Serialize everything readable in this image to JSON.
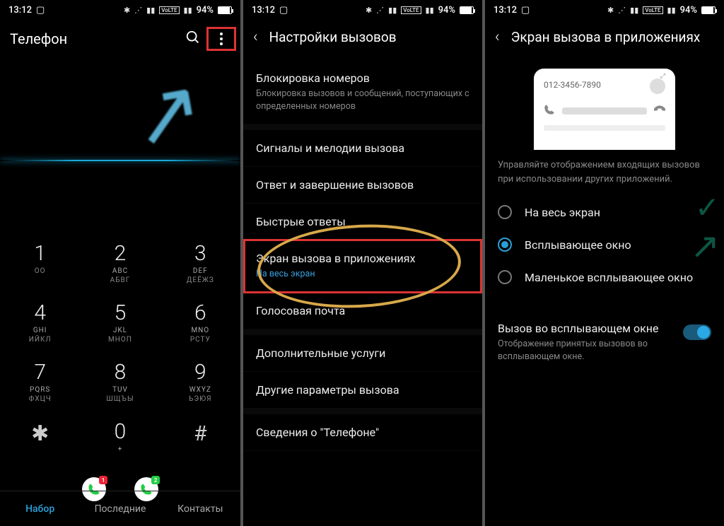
{
  "status": {
    "time": "13:12",
    "battery": "94%"
  },
  "screen1": {
    "title": "Телефон",
    "keys": [
      [
        {
          "d": "1",
          "s1": "",
          "s2": "ОО"
        },
        {
          "d": "2",
          "s1": "ABC",
          "s2": "АБВГ"
        },
        {
          "d": "3",
          "s1": "DEF",
          "s2": "ДЕЁЖЗ"
        }
      ],
      [
        {
          "d": "4",
          "s1": "GHI",
          "s2": "ИЙКЛ"
        },
        {
          "d": "5",
          "s1": "JKL",
          "s2": "МНОП"
        },
        {
          "d": "6",
          "s1": "MNO",
          "s2": "РСТУ"
        }
      ],
      [
        {
          "d": "7",
          "s1": "PQRS",
          "s2": "ФХЦЧ"
        },
        {
          "d": "8",
          "s1": "TUV",
          "s2": "ШЩЪЫ"
        },
        {
          "d": "9",
          "s1": "WXYZ",
          "s2": "ЬЭЮЯ"
        }
      ],
      [
        {
          "d": "✱",
          "s1": "",
          "s2": ""
        },
        {
          "d": "0",
          "s1": "+",
          "s2": ""
        },
        {
          "d": "#",
          "s1": "",
          "s2": ""
        }
      ]
    ],
    "badge1": "1",
    "badge2": "2",
    "tabs": {
      "t1": "Набор",
      "t2": "Последние",
      "t3": "Контакты"
    }
  },
  "screen2": {
    "title": "Настройки вызовов",
    "items": {
      "block_t": "Блокировка номеров",
      "block_s": "Блокировка вызовов и сообщений, поступающих с определенных номеров",
      "ring": "Сигналы и мелодии вызова",
      "answer": "Ответ и завершение вызовов",
      "quick": "Быстрые ответы",
      "screen_t": "Экран вызова в приложениях",
      "screen_s": "На весь экран",
      "voicemail": "Голосовая почта",
      "extra": "Дополнительные услуги",
      "other": "Другие параметры вызова",
      "about": "Сведения о \"Телефоне\""
    }
  },
  "screen3": {
    "title": "Экран вызова в приложениях",
    "preview_number": "012-3456-7890",
    "desc": "Управляйте отображением входящих вызовов при использовании других приложений.",
    "opt1": "На весь экран",
    "opt2": "Всплывающее окно",
    "opt3": "Маленькое всплывающее окно",
    "toggle_t": "Вызов во всплывающем окне",
    "toggle_s": "Отображение принятых вызовов во всплывающем окне."
  }
}
